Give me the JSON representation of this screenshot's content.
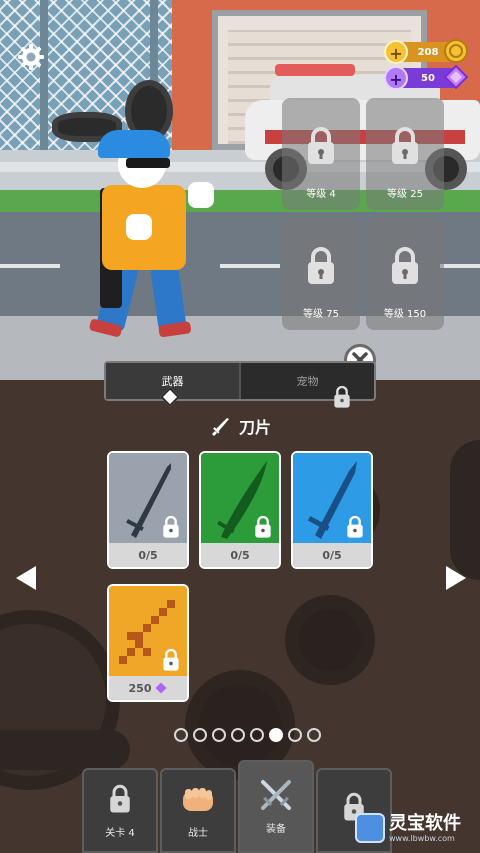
{
  "hud": {
    "coins": "208",
    "gems": "50"
  },
  "locked_slots": [
    {
      "label": "等级 4"
    },
    {
      "label": "等级 25"
    },
    {
      "label": "等级 75"
    },
    {
      "label": "等级 150"
    }
  ],
  "tabs": [
    {
      "label": "武器",
      "active": true
    },
    {
      "label": "宠物",
      "active": false,
      "locked": true
    }
  ],
  "category": {
    "title": "刀片",
    "icon": "blade-icon"
  },
  "cards": [
    {
      "rarity": "common",
      "color": "#9aa3ad",
      "item": "sword-icon",
      "progress": "0/5",
      "locked": true
    },
    {
      "rarity": "rare",
      "color": "#2c9b3a",
      "item": "saber-icon",
      "progress": "0/5",
      "locked": true
    },
    {
      "rarity": "epic",
      "color": "#2d9be6",
      "item": "sword-icon",
      "progress": "0/5",
      "locked": true
    },
    {
      "rarity": "legendary",
      "color": "#f0a626",
      "item": "pixel-sword-icon",
      "price": "250",
      "price_icon": "gem-icon",
      "locked": true
    }
  ],
  "pagination": {
    "total": 8,
    "current": 6
  },
  "nav": [
    {
      "label": "关卡 4",
      "icon": "lock-icon",
      "active": false
    },
    {
      "label": "战士",
      "icon": "fist-icon",
      "active": false
    },
    {
      "label": "装备",
      "icon": "crossed-swords-icon",
      "active": true
    },
    {
      "label": "",
      "icon": "lock-icon",
      "active": false
    }
  ],
  "watermark": {
    "title": "灵宝软件",
    "url": "www.lbwbw.com"
  },
  "colors": {
    "coin": "#d99420",
    "gem": "#7a3bd6",
    "panel_bg": "#44362e"
  }
}
